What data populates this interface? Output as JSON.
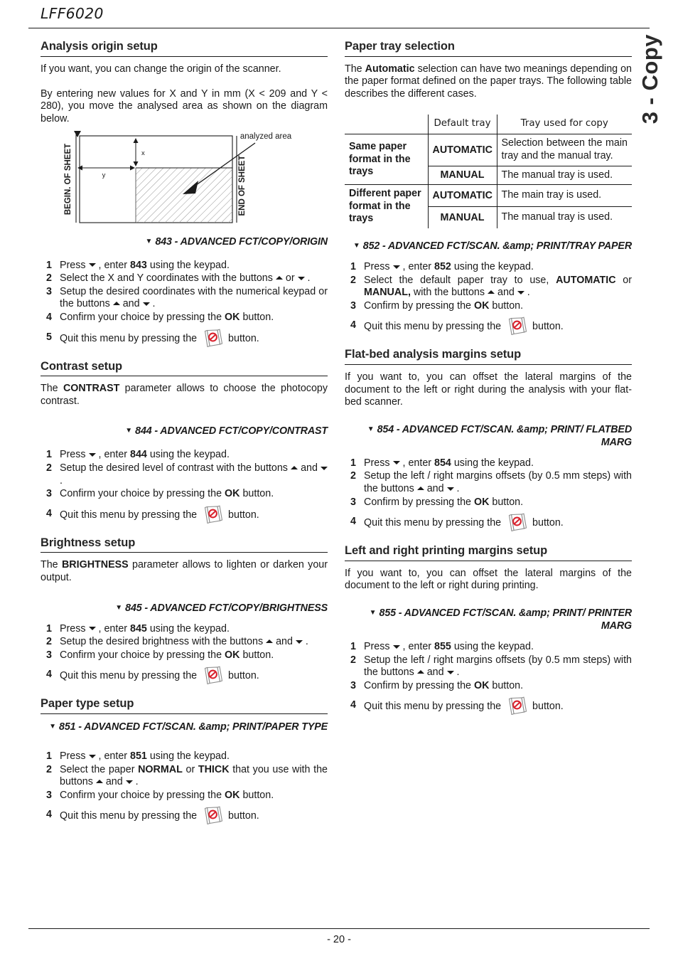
{
  "header": {
    "title": "LFF6020"
  },
  "side_tab": {
    "label": "3 - Copy"
  },
  "footer": {
    "page": "- 20 -"
  },
  "left_column": {
    "analysis_origin": {
      "heading": "Analysis origin setup",
      "para1": "If you want, you can change the origin of the scanner.",
      "para2": "By entering new values for X and Y in mm (X < 209 and Y < 280), you move the analysed area as shown on the diagram below.",
      "diagram": {
        "label_left": "BEGIN. OF SHEET",
        "label_right": "END OF SHEET",
        "label_area": "analyzed area",
        "label_x": "x",
        "label_y": "y"
      },
      "menupath": "843 - ADVANCED FCT/COPY/ORIGIN",
      "steps": [
        {
          "n": "1",
          "html": "Press <span class=\"arr-d\" data-name=\"down-arrow-icon\"></span> , enter <b>843</b> using the keypad."
        },
        {
          "n": "2",
          "html": "Select the X and Y coordinates with the buttons <span class=\"arr-u\" data-name=\"up-arrow-icon\"></span> or <span class=\"arr-d\" data-name=\"down-arrow-icon\"></span> ."
        },
        {
          "n": "3",
          "html": "Setup the desired coordinates with the numerical keypad or the buttons <span class=\"arr-u\" data-name=\"up-arrow-icon\"></span> and <span class=\"arr-d\" data-name=\"down-arrow-icon\"></span> ."
        },
        {
          "n": "4",
          "html": "Confirm your choice by pressing the <b>OK</b> button."
        },
        {
          "n": "5",
          "html": "Quit this menu by pressing the <span class=\"stopkey-slot\"></span> button.",
          "quit": true
        }
      ]
    },
    "contrast": {
      "heading": "Contrast setup",
      "para1": "The <b>CONTRAST</b> parameter allows to choose the photocopy contrast.",
      "menupath": "844 - ADVANCED FCT/COPY/CONTRAST",
      "steps": [
        {
          "n": "1",
          "html": "Press <span class=\"arr-d\" data-name=\"down-arrow-icon\"></span> , enter <b>844</b> using the keypad."
        },
        {
          "n": "2",
          "html": "Setup the desired level of contrast with the buttons <span class=\"arr-u\" data-name=\"up-arrow-icon\"></span> and <span class=\"arr-d\" data-name=\"down-arrow-icon\"></span> ."
        },
        {
          "n": "3",
          "html": "Confirm your choice by pressing the <b>OK</b> button."
        },
        {
          "n": "4",
          "html": "Quit this menu by pressing the <span class=\"stopkey-slot\"></span> button.",
          "quit": true
        }
      ]
    },
    "brightness": {
      "heading": "Brightness setup",
      "para1": "The <b>BRIGHTNESS</b> parameter allows to lighten or darken your output.",
      "menupath": "845 - ADVANCED FCT/COPY/BRIGHTNESS",
      "steps": [
        {
          "n": "1",
          "html": "Press <span class=\"arr-d\" data-name=\"down-arrow-icon\"></span> , enter <b>845</b> using the keypad."
        },
        {
          "n": "2",
          "html": "Setup the desired brightness with the buttons <span class=\"arr-u\" data-name=\"up-arrow-icon\"></span> and <span class=\"arr-d\" data-name=\"down-arrow-icon\"></span> ."
        },
        {
          "n": "3",
          "html": "Confirm your choice by pressing the <b>OK</b> button."
        },
        {
          "n": "4",
          "html": "Quit this menu by pressing the <span class=\"stopkey-slot\"></span> button.",
          "quit": true
        }
      ]
    },
    "paper_type": {
      "heading": "Paper type setup",
      "menupath": "851 - ADVANCED FCT/SCAN. &amp; PRINT/PAPER TYPE",
      "steps": [
        {
          "n": "1",
          "html": "Press <span class=\"arr-d\" data-name=\"down-arrow-icon\"></span> , enter <b>851</b> using the keypad."
        },
        {
          "n": "2",
          "html": "Select the paper <b>NORMAL</b> or <b>THICK</b> that you use with the buttons <span class=\"arr-u\" data-name=\"up-arrow-icon\"></span> and <span class=\"arr-d\" data-name=\"down-arrow-icon\"></span> ."
        },
        {
          "n": "3",
          "html": "Confirm your choice by pressing the <b>OK</b> button."
        },
        {
          "n": "4",
          "html": "Quit this menu by pressing the <span class=\"stopkey-slot\"></span> button.",
          "quit": true
        }
      ]
    }
  },
  "right_column": {
    "paper_tray": {
      "heading": "Paper tray selection",
      "para1": "The <b>Automatic</b> selection can have two meanings depending on the paper format defined on the paper trays. The following table describes the different cases.",
      "table": {
        "columns": [
          "",
          "Default tray",
          "Tray used for copy"
        ],
        "rows": [
          {
            "group": "Same paper format in the trays",
            "default_tray": "AUTOMATIC",
            "used": "Selection between the main tray and the manual tray."
          },
          {
            "group": "",
            "default_tray": "MANUAL",
            "used": "The manual tray is used."
          },
          {
            "group": "Different paper format in the trays",
            "default_tray": "AUTOMATIC",
            "used": "The main tray is used."
          },
          {
            "group": "",
            "default_tray": "MANUAL",
            "used": "The manual tray is used."
          }
        ]
      },
      "menupath": "852 - ADVANCED FCT/SCAN. &amp; PRINT/TRAY PAPER",
      "steps": [
        {
          "n": "1",
          "html": "Press <span class=\"arr-d\" data-name=\"down-arrow-icon\"></span> , enter <b>852</b> using the keypad."
        },
        {
          "n": "2",
          "html": "Select the default paper tray to use, <b>AUTOMATIC</b> or <b>MANUAL,</b> with the buttons <span class=\"arr-u\" data-name=\"up-arrow-icon\"></span> and <span class=\"arr-d\" data-name=\"down-arrow-icon\"></span> ."
        },
        {
          "n": "3",
          "html": "Confirm by pressing the <b>OK</b> button."
        },
        {
          "n": "4",
          "html": "Quit this menu by pressing the <span class=\"stopkey-slot\"></span> button.",
          "quit": true
        }
      ]
    },
    "flatbed_margins": {
      "heading": "Flat-bed analysis margins setup",
      "para1": "If you want to, you can offset the lateral margins of the document to the left or right during the analysis with your flat-bed scanner.",
      "menupath": "854 - ADVANCED FCT/SCAN. &amp; PRINT/ FLATBED MARG",
      "steps": [
        {
          "n": "1",
          "html": "Press <span class=\"arr-d\" data-name=\"down-arrow-icon\"></span> , enter <b>854</b> using the keypad."
        },
        {
          "n": "2",
          "html": "Setup the left / right margins offsets (by 0.5 mm steps) with the buttons <span class=\"arr-u\" data-name=\"up-arrow-icon\"></span> and <span class=\"arr-d\" data-name=\"down-arrow-icon\"></span> ."
        },
        {
          "n": "3",
          "html": "Confirm by pressing the <b>OK</b> button."
        },
        {
          "n": "4",
          "html": "Quit this menu by pressing the <span class=\"stopkey-slot\"></span> button.",
          "quit": true
        }
      ]
    },
    "printing_margins": {
      "heading": "Left and right printing margins setup",
      "para1": "If you want to, you can offset the lateral margins of the document to the left or right during printing.",
      "menupath": "855 - ADVANCED FCT/SCAN. &amp; PRINT/ PRINTER MARG",
      "steps": [
        {
          "n": "1",
          "html": "Press <span class=\"arr-d\" data-name=\"down-arrow-icon\"></span> , enter <b>855</b> using the keypad."
        },
        {
          "n": "2",
          "html": "Setup the left / right margins offsets (by 0.5 mm steps) with the buttons <span class=\"arr-u\" data-name=\"up-arrow-icon\"></span> and <span class=\"arr-d\" data-name=\"down-arrow-icon\"></span> ."
        },
        {
          "n": "3",
          "html": "Confirm by pressing the <b>OK</b> button."
        },
        {
          "n": "4",
          "html": "Quit this menu by pressing the <span class=\"stopkey-slot\"></span> button.",
          "quit": true
        }
      ]
    }
  },
  "icons": {
    "stop_key": "stop-key-icon",
    "down_arrow": "down-arrow-icon",
    "up_arrow": "up-arrow-icon",
    "menu_bullet": "triangle-bullet-icon"
  },
  "colors": {
    "stop_red": "#d9232e",
    "text": "#1a1a1a",
    "heading": "#262626"
  }
}
